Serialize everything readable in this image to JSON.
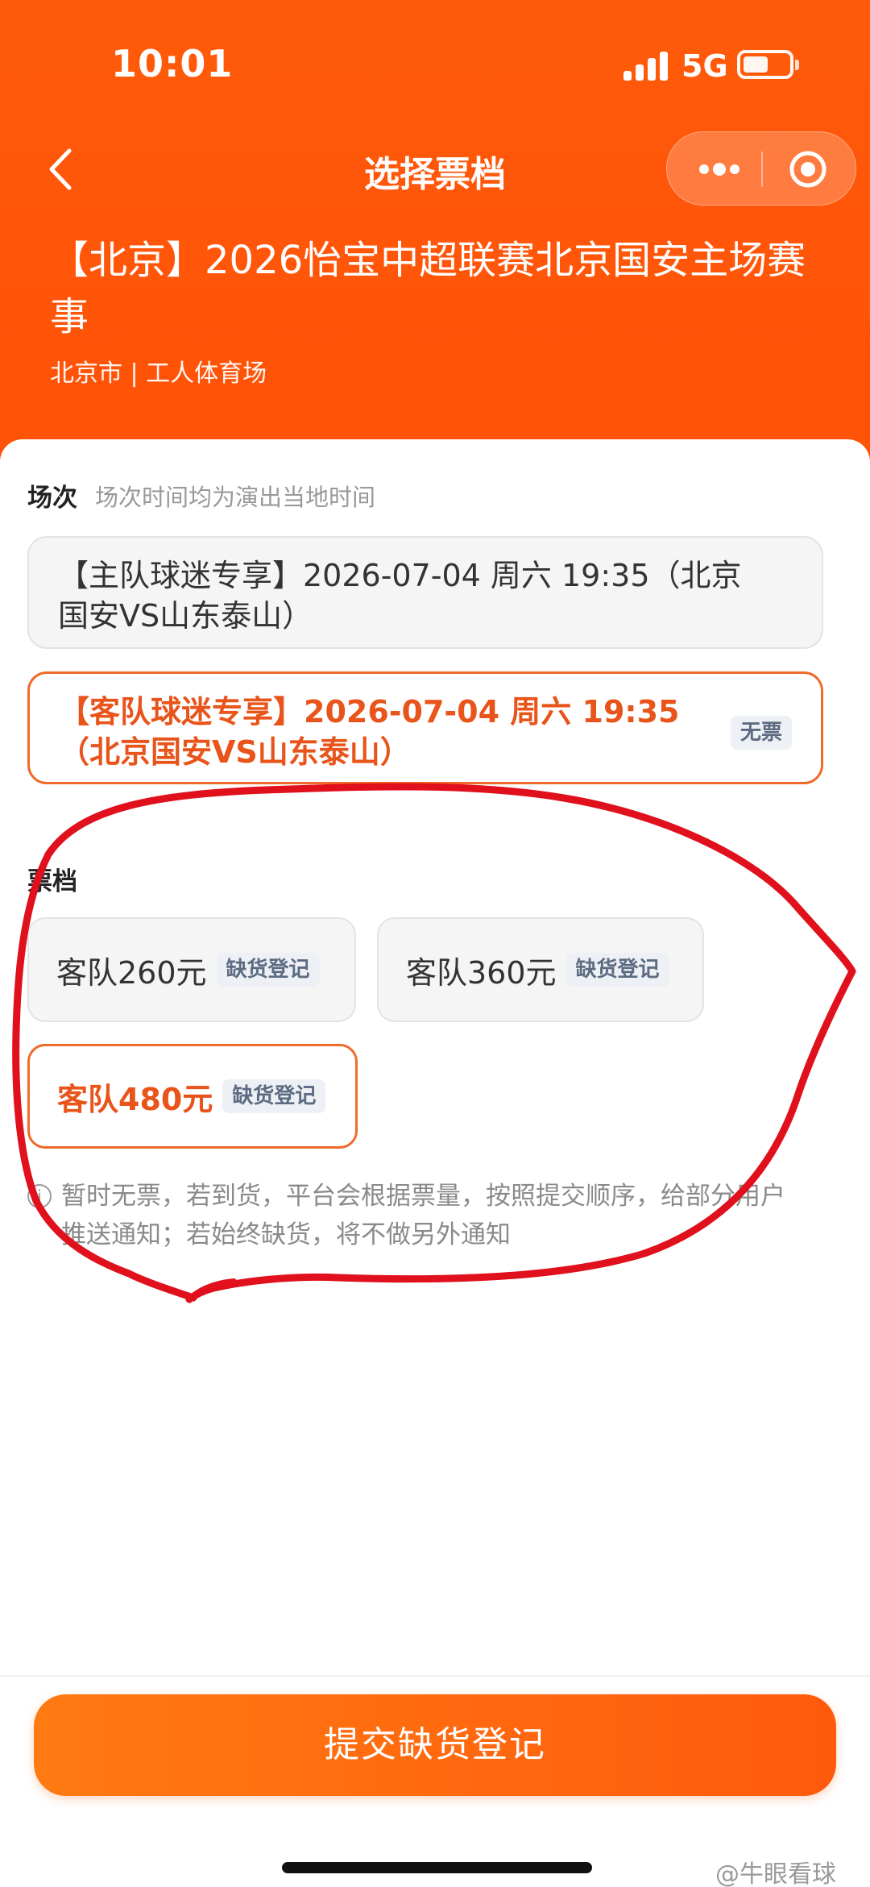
{
  "status_bar": {
    "time": "10:01",
    "network": "5G"
  },
  "nav": {
    "title": "选择票档"
  },
  "event": {
    "title": "【北京】2026怡宝中超联赛北京国安主场赛事",
    "venue": "北京市 | 工人体育场"
  },
  "sessions": {
    "label": "场次",
    "hint": "场次时间均为演出当地时间",
    "items": [
      {
        "line1": "【主队球迷专享】2026-07-04 周六 19:35（北京",
        "line2": "国安VS山东泰山）",
        "tag": ""
      },
      {
        "line1": "【客队球迷专享】2026-07-04 周六 19:35",
        "line2": "（北京国安VS山东泰山）",
        "tag": "无票"
      }
    ]
  },
  "tiers": {
    "label": "票档",
    "items": [
      {
        "name": "客队260元",
        "tag": "缺货登记"
      },
      {
        "name": "客队360元",
        "tag": "缺货登记"
      },
      {
        "name": "客队480元",
        "tag": "缺货登记"
      }
    ]
  },
  "notice": {
    "line1": "暂时无票，若到货，平台会根据票量，按照提交顺序，给部分用户",
    "line2": "推送通知；若始终缺货，将不做另外通知"
  },
  "footer": {
    "submit_label": "提交缺货登记"
  },
  "watermark": "@牛眼看球",
  "colors": {
    "brand": "#ff5a0a",
    "accent": "#e8541a",
    "annotation": "#e0101c"
  }
}
